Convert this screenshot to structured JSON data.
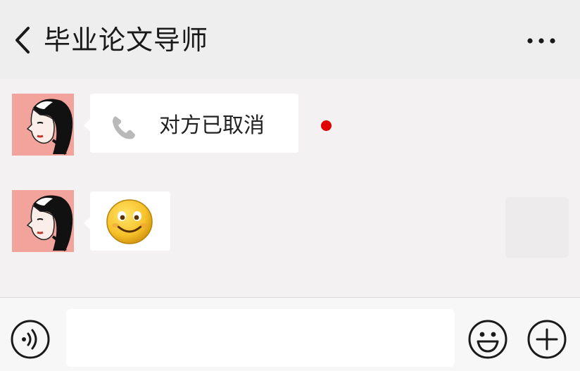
{
  "header": {
    "title": "毕业论文导师",
    "back_icon": "chevron-left-icon",
    "more_icon": "ellipsis-icon"
  },
  "messages": [
    {
      "type": "voice-call",
      "text": "对方已取消",
      "icon": "phone-icon",
      "unread_dot": true,
      "dot_color": "#e10000"
    },
    {
      "type": "emoji",
      "icon": "smiley-emoji-icon"
    }
  ],
  "input_bar": {
    "voice_icon": "voice-mode-icon",
    "emoji_icon": "emoji-icon",
    "plus_icon": "plus-icon",
    "input_value": ""
  },
  "colors": {
    "background": "#f2f0f1",
    "bubble": "#ffffff",
    "avatar_bg": "#f2a39c",
    "unread_dot": "#e10000"
  }
}
